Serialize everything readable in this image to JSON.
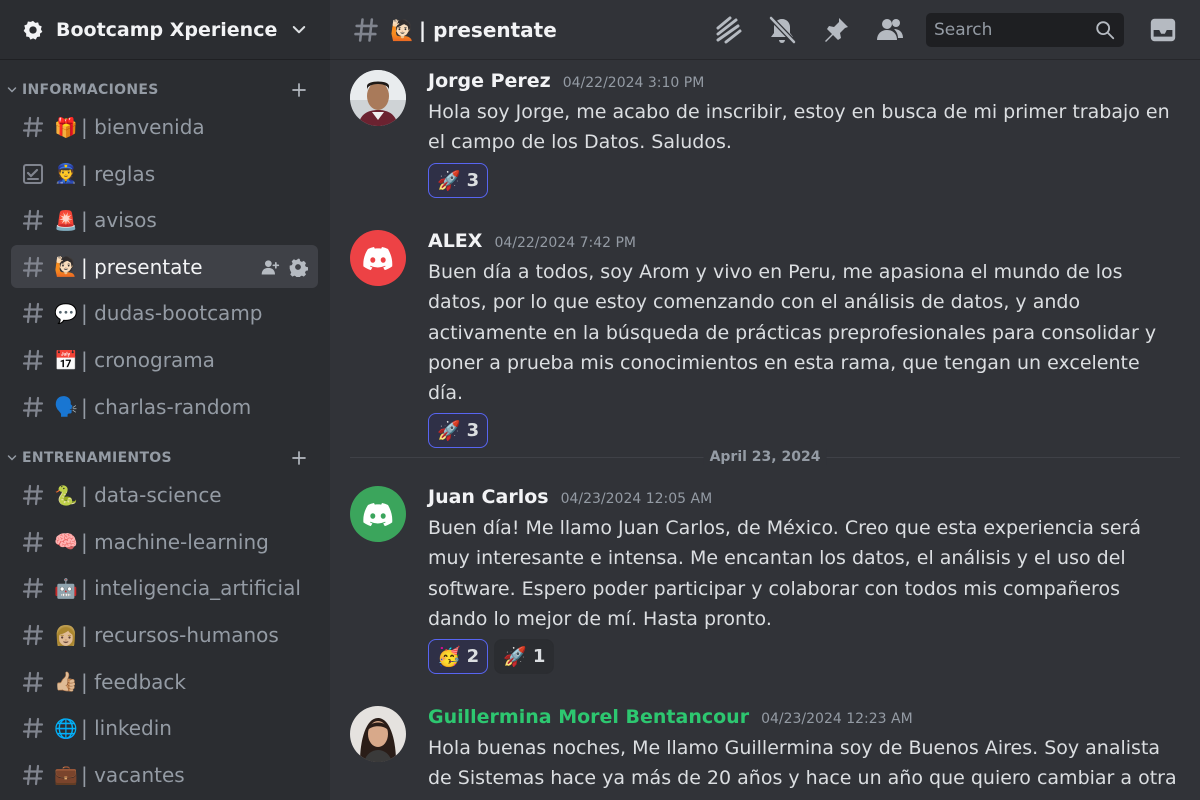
{
  "server": {
    "name": "Bootcamp Xperience"
  },
  "categories": [
    {
      "label": "INFORMACIONES",
      "channels": [
        {
          "icon": "hash-icon",
          "emoji": "🎁",
          "name": "| bienvenida"
        },
        {
          "icon": "rules-checkbox-icon",
          "emoji": "👮",
          "name": "| reglas"
        },
        {
          "icon": "hash-icon",
          "emoji": "🚨",
          "name": "| avisos"
        },
        {
          "icon": "hash-icon",
          "emoji": "🙋🏻",
          "name": "| presentate",
          "active": true
        },
        {
          "icon": "hash-icon",
          "emoji": "💬",
          "name": "| dudas-bootcamp"
        },
        {
          "icon": "hash-icon",
          "emoji": "📅",
          "name": "| cronograma"
        },
        {
          "icon": "hash-icon",
          "emoji": "🗣️",
          "name": "| charlas-random"
        }
      ]
    },
    {
      "label": "ENTRENAMIENTOS",
      "channels": [
        {
          "icon": "hash-icon",
          "emoji": "🐍",
          "name": "| data-science"
        },
        {
          "icon": "hash-icon",
          "emoji": "🧠",
          "name": "| machine-learning"
        },
        {
          "icon": "hash-icon",
          "emoji": "🤖",
          "name": "| inteligencia_artificial"
        },
        {
          "icon": "hash-icon",
          "emoji": "👩🏼",
          "name": "| recursos-humanos"
        },
        {
          "icon": "hash-icon",
          "emoji": "👍🏼",
          "name": "| feedback"
        },
        {
          "icon": "hash-icon",
          "emoji": "🌐",
          "name": "| linkedin"
        },
        {
          "icon": "hash-icon",
          "emoji": "💼",
          "name": "| vacantes"
        }
      ]
    }
  ],
  "header": {
    "emoji": "🙋🏻",
    "title": "| presentate",
    "search_placeholder": "Search",
    "icons": [
      "threads-icon",
      "mute-bell-icon",
      "pin-icon",
      "members-icon",
      "search-icon",
      "inbox-icon"
    ]
  },
  "messages": [
    {
      "author": "Jorge Perez",
      "timestamp": "04/22/2024 3:10 PM",
      "text": "Hola soy Jorge, me acabo de inscribir, estoy en busca de mi primer trabajo en el campo de los Datos. Saludos.",
      "reactions": [
        {
          "emoji": "🚀",
          "count": "3",
          "me": true
        }
      ]
    },
    {
      "author": "ALEX",
      "timestamp": "04/22/2024 7:42 PM",
      "text": "Buen día a todos, soy Arom y vivo en Peru, me apasiona el mundo de los datos, por lo que estoy comenzando con el análisis de datos, y ando activamente en la búsqueda de prácticas preprofesionales para consolidar y poner a prueba mis conocimientos en esta rama, que tengan un excelente día.",
      "reactions": [
        {
          "emoji": "🚀",
          "count": "3",
          "me": true
        }
      ]
    },
    {
      "author": "Juan Carlos",
      "timestamp": "04/23/2024 12:05 AM",
      "text": "Buen día! Me llamo Juan Carlos, de México. Creo que esta experiencia será muy interesante e intensa. Me encantan los datos, el análisis y el uso del software. Espero poder participar y colaborar con todos mis compañeros dando lo mejor de mí. Hasta pronto.",
      "reactions": [
        {
          "emoji": "🥳",
          "count": "2",
          "me": true
        },
        {
          "emoji": "🚀",
          "count": "1",
          "me": false
        }
      ]
    },
    {
      "author": "Guillermina Morel Bentancour",
      "timestamp": "04/23/2024 12:23 AM",
      "text": "Hola buenas noches, Me llamo Guillermina soy de Buenos Aires. Soy analista de Sistemas hace ya más de 20 años y hace un año que quiero cambiar a otra rama.",
      "reactions": []
    }
  ],
  "date_divider": "April 23, 2024",
  "colors": {
    "accent": "#5865f2",
    "discord_red": "#ed4245",
    "discord_green": "#3ba55c",
    "role_green": "#2dc770"
  }
}
